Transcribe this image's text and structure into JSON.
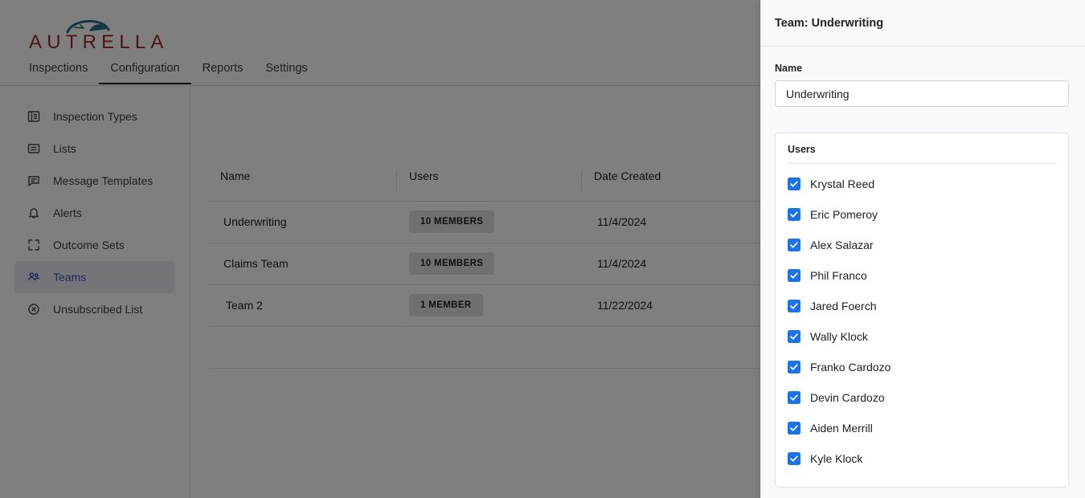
{
  "brand": {
    "name": "AUTRELLA",
    "logo_text_color": "#9e2a2b",
    "logo_arc_color": "#2a6e82"
  },
  "nav": {
    "tabs": [
      {
        "label": "Inspections",
        "active": false
      },
      {
        "label": "Configuration",
        "active": true
      },
      {
        "label": "Reports",
        "active": false
      },
      {
        "label": "Settings",
        "active": false
      }
    ]
  },
  "sidebar": {
    "items": [
      {
        "label": "Inspection Types",
        "icon": "document-list-icon",
        "active": false
      },
      {
        "label": "Lists",
        "icon": "list-box-icon",
        "active": false
      },
      {
        "label": "Message Templates",
        "icon": "message-bubble-icon",
        "active": false
      },
      {
        "label": "Alerts",
        "icon": "bell-icon",
        "active": false
      },
      {
        "label": "Outcome Sets",
        "icon": "expand-arrows-icon",
        "active": false
      },
      {
        "label": "Teams",
        "icon": "people-group-icon",
        "active": true
      },
      {
        "label": "Unsubscribed List",
        "icon": "circle-x-icon",
        "active": false
      }
    ],
    "active_color": "#3f51b5"
  },
  "table": {
    "columns": [
      "Name",
      "Users",
      "Date Created"
    ],
    "rows": [
      {
        "name": "Underwriting",
        "users_badge": "10 MEMBERS",
        "date_created": "11/4/2024"
      },
      {
        "name": "Claims Team",
        "users_badge": "10 MEMBERS",
        "date_created": "11/4/2024"
      },
      {
        "name": "Team 2",
        "users_badge": "1 MEMBER",
        "date_created": "11/22/2024"
      }
    ]
  },
  "panel": {
    "title": "Team: Underwriting",
    "name_label": "Name",
    "name_value": "Underwriting",
    "name_placeholder": "Name",
    "users_card_title": "Users",
    "checkbox_color": "#1a73e8",
    "users": [
      {
        "name": "Krystal Reed",
        "checked": true
      },
      {
        "name": "Eric Pomeroy",
        "checked": true
      },
      {
        "name": "Alex Salazar",
        "checked": true
      },
      {
        "name": "Phil Franco",
        "checked": true
      },
      {
        "name": "Jared Foerch",
        "checked": true
      },
      {
        "name": "Wally Klock",
        "checked": true
      },
      {
        "name": "Franko Cardozo",
        "checked": true
      },
      {
        "name": "Devin Cardozo",
        "checked": true
      },
      {
        "name": "Aiden Merrill",
        "checked": true
      },
      {
        "name": "Kyle Klock",
        "checked": true
      }
    ]
  }
}
